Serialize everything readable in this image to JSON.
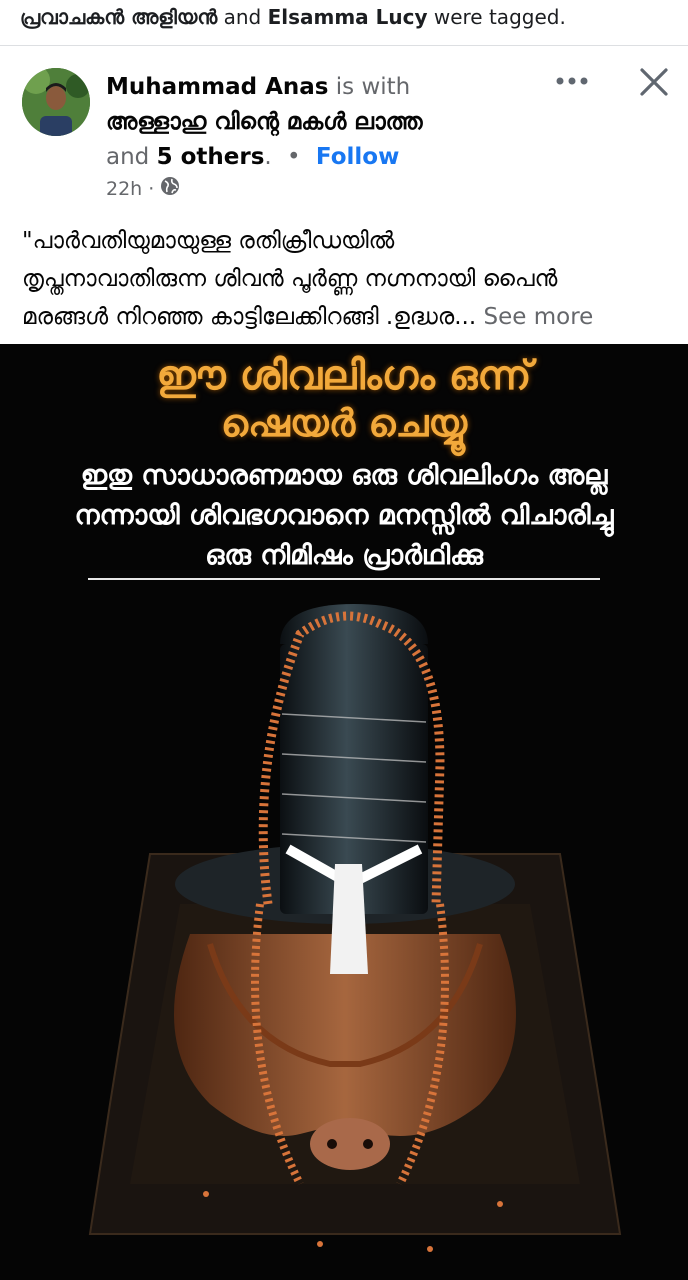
{
  "tag_line": {
    "person1": "പ്രവാചകൻ അളിയൻ",
    "joiner": "and",
    "person2": "Elsamma Lucy",
    "suffix": "were tagged."
  },
  "post": {
    "author": "Muhammad Anas",
    "is_with": "is with",
    "with_person": "അള്ളാഹു വിന്റെ മകൾ ലാത്ത",
    "and_text": "and",
    "others": "5 others",
    "dot": ".",
    "bullet": "•",
    "follow_label": "Follow",
    "time": "22h",
    "meta_sep": "·",
    "privacy_icon": "globe-icon",
    "text_line1": "\"പാർവതിയുമായുള്ള രതിക്രീഡയിൽ",
    "text_line2": "തൃപ്തനാവാതിരുന്ന ശിവൻ പൂർണ്ണ നഗ്നനായി പൈൻ",
    "text_line3": "മരങ്ങൾ നിറഞ്ഞ കാട്ടിലേക്കിറങ്ങി .ഉദ്ധര...",
    "see_more": "See more"
  },
  "image": {
    "title_line1": "ഈ ശിവലിംഗം ഒന്ന്",
    "title_line2": "ഷെയർ ചെയ്യൂ",
    "sub_line1": "ഇതു സാധാരണമായ ഒരു ശിവലിംഗം അല്ല",
    "sub_line2": "നന്നായി ശിവഭഗവാനെ മനസ്സിൽ വിചാരിച്ചു",
    "sub_line3": "ഒരു നിമിഷം പ്രാർഥിക്കു"
  },
  "colors": {
    "follow": "#1877f2",
    "muted": "#65676b",
    "title_orange": "#f2a93b",
    "image_bg": "#050505"
  }
}
